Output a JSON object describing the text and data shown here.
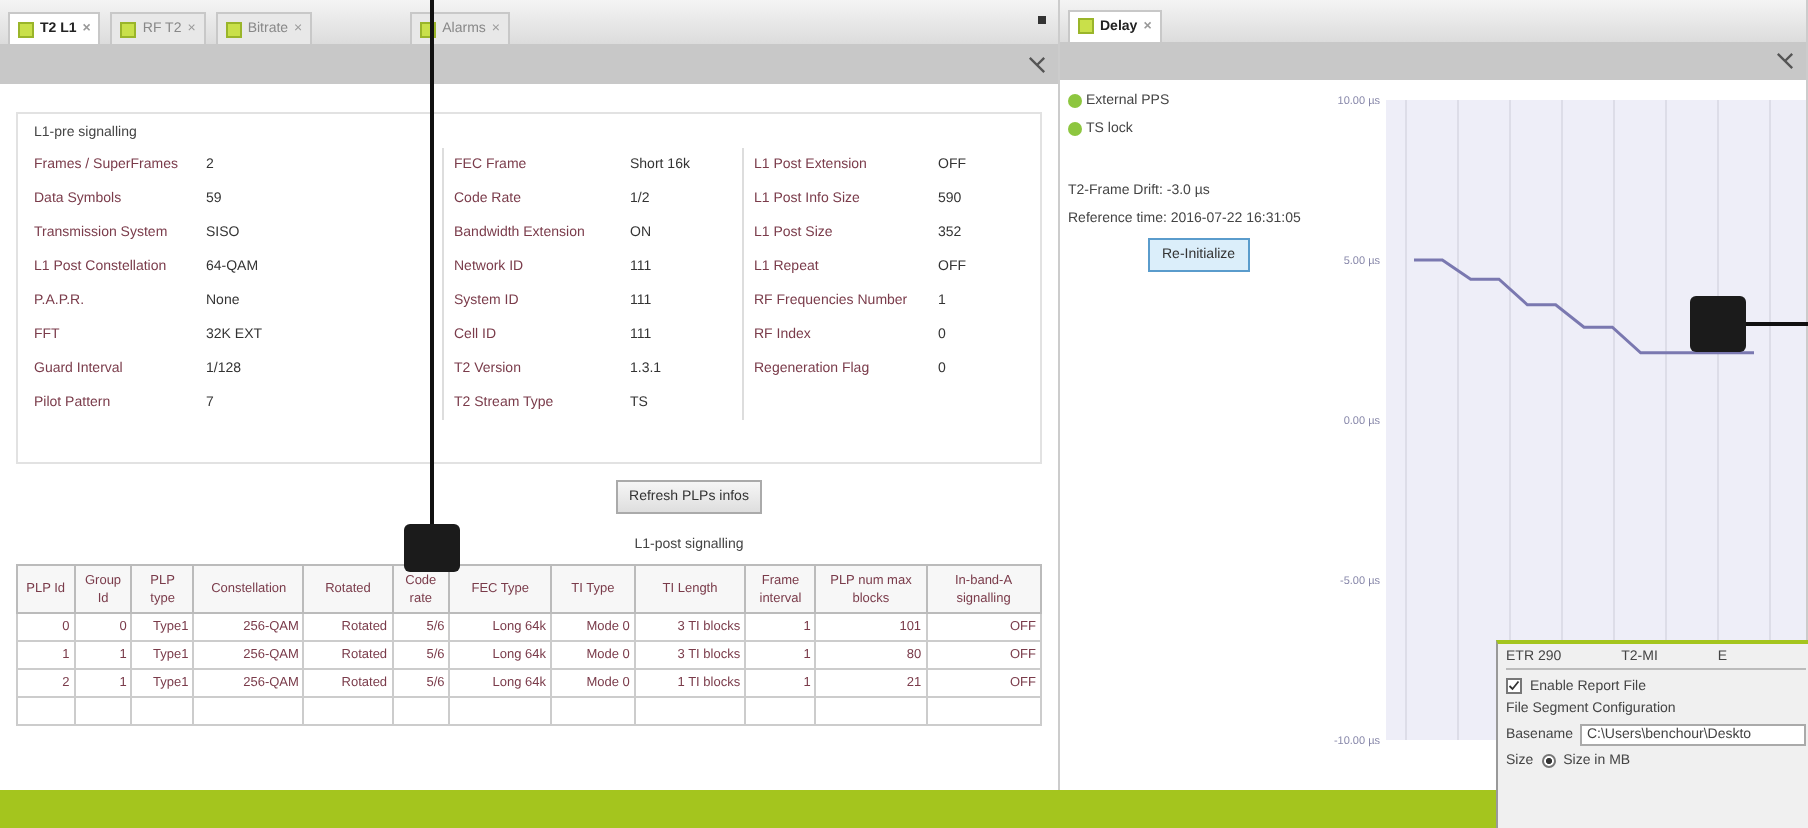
{
  "left_panel": {
    "tabs": [
      {
        "label": "T2 L1",
        "close": "×",
        "selected": true
      },
      {
        "label": "RF T2",
        "close": "×",
        "selected": false
      },
      {
        "label": "Bitrate",
        "close": "×",
        "selected": false
      },
      {
        "label": "Alarms",
        "close": "×",
        "selected": false
      }
    ],
    "l1_pre": {
      "title": "L1-pre signalling",
      "columns": [
        [
          {
            "label": "Frames / SuperFrames",
            "value": "2"
          },
          {
            "label": "Data Symbols",
            "value": "59"
          },
          {
            "label": "Transmission System",
            "value": "SISO"
          },
          {
            "label": "L1 Post Constellation",
            "value": "64-QAM"
          },
          {
            "label": "P.A.P.R.",
            "value": "None"
          },
          {
            "label": "FFT",
            "value": "32K EXT"
          },
          {
            "label": "Guard Interval",
            "value": "1/128"
          },
          {
            "label": "Pilot Pattern",
            "value": "7"
          }
        ],
        [
          {
            "label": "FEC Frame",
            "value": "Short 16k"
          },
          {
            "label": "Code Rate",
            "value": "1/2"
          },
          {
            "label": "Bandwidth Extension",
            "value": "ON"
          },
          {
            "label": "Network ID",
            "value": "111"
          },
          {
            "label": "System ID",
            "value": "111"
          },
          {
            "label": "Cell ID",
            "value": "111"
          },
          {
            "label": "T2 Version",
            "value": "1.3.1"
          },
          {
            "label": "T2 Stream Type",
            "value": "TS"
          }
        ],
        [
          {
            "label": "L1 Post Extension",
            "value": "OFF"
          },
          {
            "label": "L1 Post Info Size",
            "value": "590"
          },
          {
            "label": "L1 Post Size",
            "value": "352"
          },
          {
            "label": "L1 Repeat",
            "value": "OFF"
          },
          {
            "label": "RF Frequencies Number",
            "value": "1"
          },
          {
            "label": "RF Index",
            "value": "0"
          },
          {
            "label": "Regeneration Flag",
            "value": "0"
          }
        ]
      ]
    },
    "refresh_button": "Refresh PLPs infos",
    "l1_post": {
      "title": "L1-post signalling",
      "columns": [
        "PLP Id",
        "Group Id",
        "PLP type",
        "Constellation",
        "Rotated",
        "Code rate",
        "FEC Type",
        "TI Type",
        "TI Length",
        "Frame interval",
        "PLP num max blocks",
        "In-band-A signalling"
      ],
      "rows": [
        [
          "0",
          "0",
          "Type1",
          "256-QAM",
          "Rotated",
          "5/6",
          "Long 64k",
          "Mode 0",
          "3 TI blocks",
          "1",
          "101",
          "OFF"
        ],
        [
          "1",
          "1",
          "Type1",
          "256-QAM",
          "Rotated",
          "5/6",
          "Long 64k",
          "Mode 0",
          "3 TI blocks",
          "1",
          "80",
          "OFF"
        ],
        [
          "2",
          "1",
          "Type1",
          "256-QAM",
          "Rotated",
          "5/6",
          "Long 64k",
          "Mode 0",
          "1 TI blocks",
          "1",
          "21",
          "OFF"
        ]
      ]
    }
  },
  "right_panel": {
    "tabs": [
      {
        "label": "Delay",
        "close": "×",
        "selected": true
      }
    ],
    "status": [
      {
        "label": "External PPS",
        "color": "#8dc63f"
      },
      {
        "label": "TS lock",
        "color": "#8dc63f"
      }
    ],
    "drift": "T2-Frame Drift: -3.0 µs",
    "reference": "Reference time: 2016-07-22 16:31:05",
    "reinit_button": "Re-Initialize",
    "chart_data": {
      "type": "line",
      "yticks": [
        {
          "value": 10,
          "label": "10.00 µs"
        },
        {
          "value": 5,
          "label": "5.00 µs"
        },
        {
          "value": 0,
          "label": "0.00 µs"
        },
        {
          "value": -5,
          "label": "-5.00 µs"
        },
        {
          "value": -10,
          "label": "-10.00 µs"
        }
      ],
      "ylim": [
        -10,
        10
      ],
      "series": [
        {
          "color": "#7a78b0",
          "values": [
            5,
            5,
            4.4,
            4.4,
            3.6,
            3.6,
            2.9,
            2.9,
            2.1,
            2.1,
            2.1,
            2.1,
            2.1
          ]
        }
      ]
    }
  },
  "dialog": {
    "tabs": [
      "ETR 290",
      "T2-MI",
      "E"
    ],
    "enable_report": {
      "label": "Enable Report File",
      "checked": true
    },
    "section": "File Segment Configuration",
    "basename": {
      "label": "Basename",
      "value": "C:\\Users\\benchour\\Deskto"
    },
    "size": {
      "label": "Size",
      "option": "Size in MB",
      "selected": true
    }
  }
}
